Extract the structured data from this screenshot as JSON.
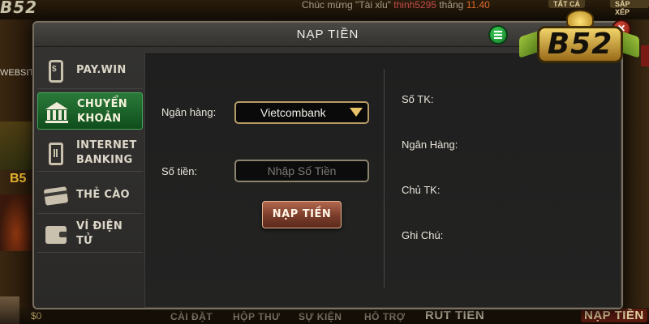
{
  "background": {
    "ticker_prefix": "Chúc mừng \"Tài xỉu\"",
    "ticker_name": "thinh5295",
    "ticker_mid": "thắng",
    "ticker_amount": "11.40",
    "top_logo": "B52",
    "top_tabs": [
      "TẤT CẢ",
      "SẮP XẾP"
    ],
    "website_label": "WEBSITE",
    "left_badge": "B5",
    "coin_amount": "$0",
    "bottom_nav": [
      "CÀI ĐẶT",
      "HỘP THƯ",
      "SỰ KIỆN",
      "HỖ TRỢ",
      "RÚT TIỀN",
      "NẠP TIỀN"
    ]
  },
  "modal": {
    "title": "NẠP TIỀN",
    "history_icon": "list-icon",
    "close_icon": "close-icon",
    "close_glyph": "×",
    "logo_text": "B52"
  },
  "sidebar": {
    "items": [
      {
        "label": "PAY.WIN",
        "icon": "phone-pay-icon",
        "active": false
      },
      {
        "label": "CHUYỂN KHOẢN",
        "icon": "bank-icon",
        "active": true
      },
      {
        "label": "INTERNET BANKING",
        "icon": "internet-banking-icon",
        "active": false
      },
      {
        "label": "THẺ CÀO",
        "icon": "card-icon",
        "active": false
      },
      {
        "label": "VÍ ĐIỆN TỬ",
        "icon": "wallet-icon",
        "active": false
      }
    ]
  },
  "form": {
    "bank_label": "Ngân hàng:",
    "bank_selected": "Vietcombank",
    "amount_label": "Số tiền:",
    "amount_value": "",
    "amount_placeholder": "Nhập Số Tiền",
    "submit_label": "NẠP TIỀN"
  },
  "account_info": {
    "account_number_label": "Số TK:",
    "bank_label": "Ngân Hàng:",
    "holder_label": "Chủ TK:",
    "note_label": "Ghi Chú:"
  },
  "colors": {
    "active_tab": "#1f6a2e",
    "select_border": "#b69b64",
    "button_bg": "#7a3c2a",
    "modal_bg": "#2f2e2c",
    "logo_gold": "#e4b22e"
  }
}
